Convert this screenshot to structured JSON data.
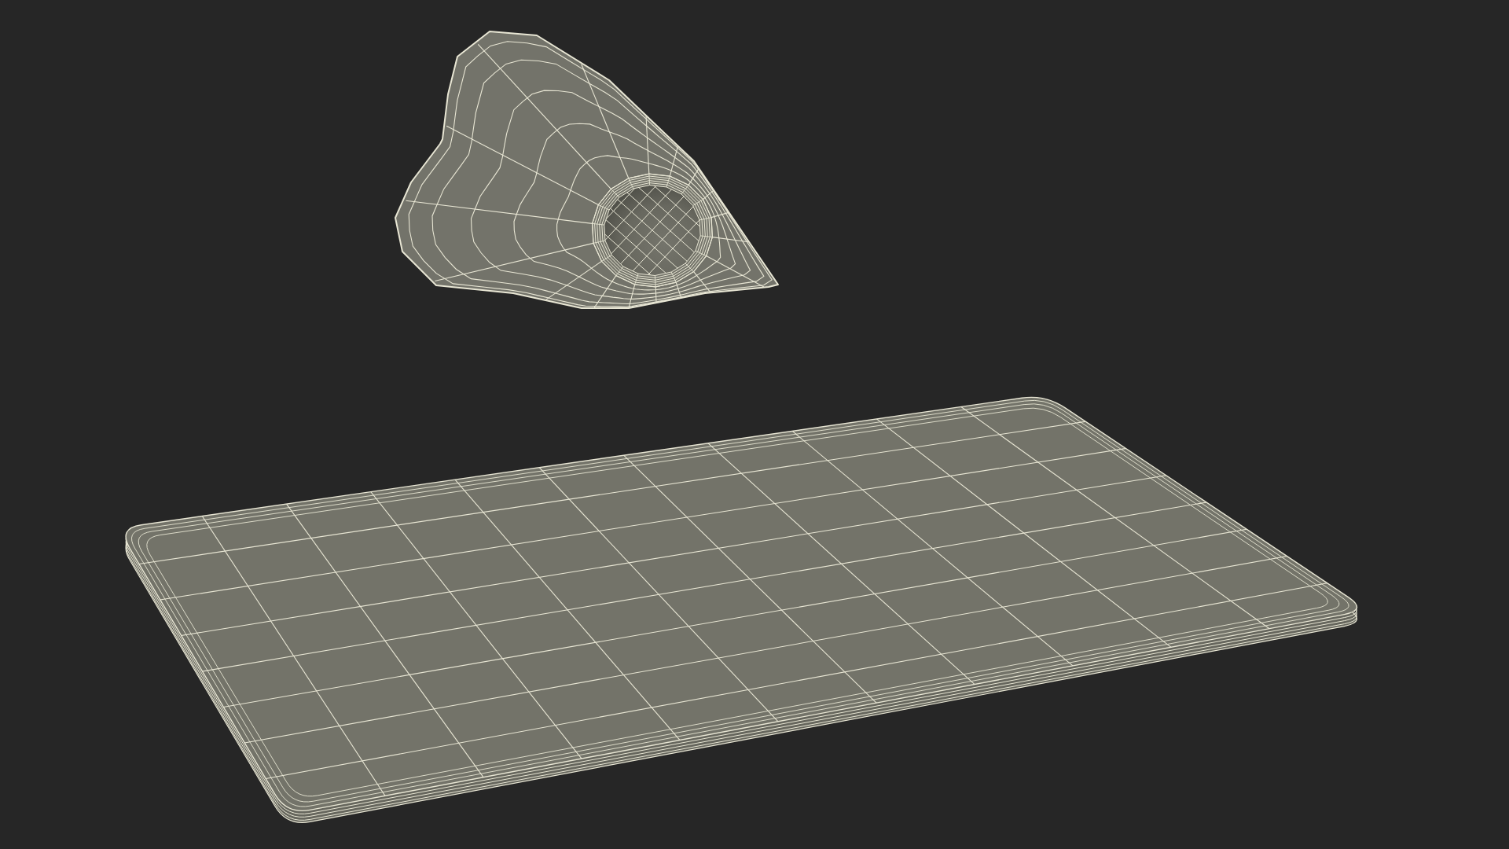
{
  "viewport": {
    "objects": [
      {
        "kind": "pick"
      },
      {
        "kind": "plate"
      }
    ]
  }
}
